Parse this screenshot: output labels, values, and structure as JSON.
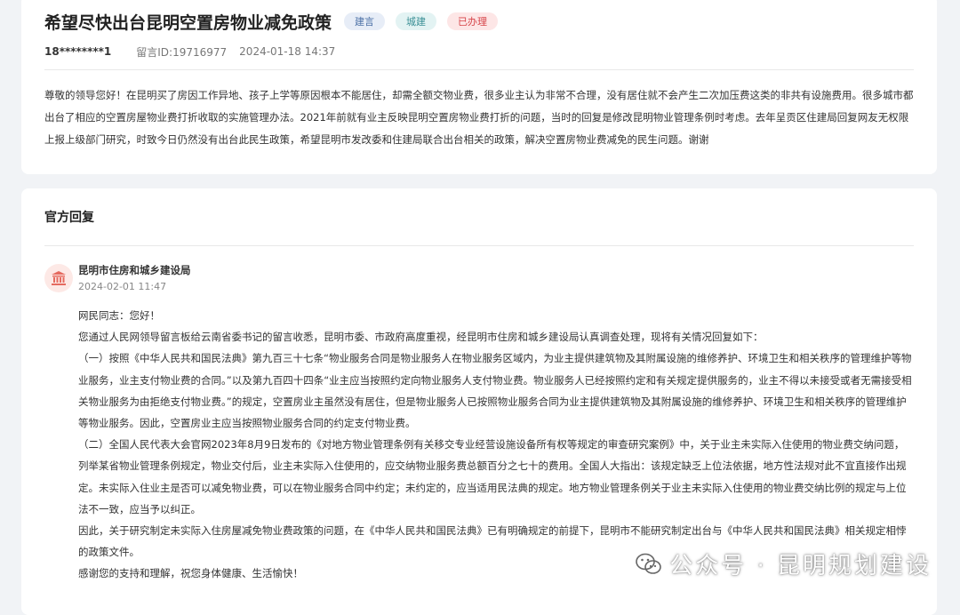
{
  "post": {
    "title": "希望尽快出台昆明空置房物业减免政策",
    "tags": [
      "建言",
      "城建",
      "已办理"
    ],
    "user_id": "18********1",
    "message_id": "留言ID:19716977",
    "datetime": "2024-01-18 14:37",
    "content": "尊敬的领导您好！在昆明买了房因工作异地、孩子上学等原因根本不能居住，却需全额交物业费，很多业主认为非常不合理，没有居住就不会产生二次加压费这类的非共有设施费用。很多城市都出台了相应的空置房屋物业费打折收取的实施管理办法。2021年前就有业主反映昆明空置房物业费打折的问题，当时的回复是修改昆明物业管理条例时考虑。去年呈贡区住建局回复网友无权限上报上级部门研究，时致今日仍然没有出台此民生政策，希望昆明市发改委和住建局联合出台相关的政策，解决空置房物业费减免的民生问题。谢谢"
  },
  "reply": {
    "heading": "官方回复",
    "department": "昆明市住房和城乡建设局",
    "datetime": "2024-02-01 11:47",
    "paragraphs": [
      "网民同志：您好！",
      "您通过人民网领导留言板给云南省委书记的留言收悉，昆明市委、市政府高度重视，经昆明市住房和城乡建设局认真调查处理，现将有关情况回复如下：",
      "（一）按照《中华人民共和国民法典》第九百三十七条“物业服务合同是物业服务人在物业服务区域内，为业主提供建筑物及其附属设施的维修养护、环境卫生和相关秩序的管理维护等物业服务，业主支付物业费的合同。”以及第九百四十四条“业主应当按照约定向物业服务人支付物业费。物业服务人已经按照约定和有关规定提供服务的，业主不得以未接受或者无需接受相关物业服务为由拒绝支付物业费。”的规定，空置房业主虽然没有居住，但是物业服务人已按照物业服务合同为业主提供建筑物及其附属设施的维修养护、环境卫生和相关秩序的管理维护等物业服务。因此，空置房业主应当按照物业服务合同的约定支付物业费。",
      "（二）全国人民代表大会官网2023年8月9日发布的《对地方物业管理条例有关移交专业经营设施设备所有权等规定的审查研究案例》中，关于业主未实际入住使用的物业费交纳问题，列举某省物业管理条例规定，物业交付后，业主未实际入住使用的，应交纳物业服务费总额百分之七十的费用。全国人大指出：该规定缺乏上位法依据，地方性法规对此不宜直接作出规定。未实际入住业主是否可以减免物业费，可以在物业服务合同中约定；未约定的，应当适用民法典的规定。地方物业管理条例关于业主未实际入住使用的物业费交纳比例的规定与上位法不一致，应当予以纠正。",
      "因此，关于研究制定未实际入住房屋减免物业费政策的问题，在《中华人民共和国民法典》已有明确规定的前提下，昆明市不能研究制定出台与《中华人民共和国民法典》相关规定相悖的政策文件。",
      "感谢您的支持和理解，祝您身体健康、生活愉快！"
    ]
  },
  "watermark": {
    "text": "公众号 · 昆明规划建设",
    "icon": "wechat-icon"
  },
  "icons": {
    "department": "government-building-icon"
  },
  "colors": {
    "tag_jianyan_bg": "#e7edf7",
    "tag_chengjian_bg": "#e3f3f3",
    "tag_done_bg": "#fde6e6",
    "tag_done_text": "#d6454a",
    "dept_icon": "#e56a5f"
  }
}
